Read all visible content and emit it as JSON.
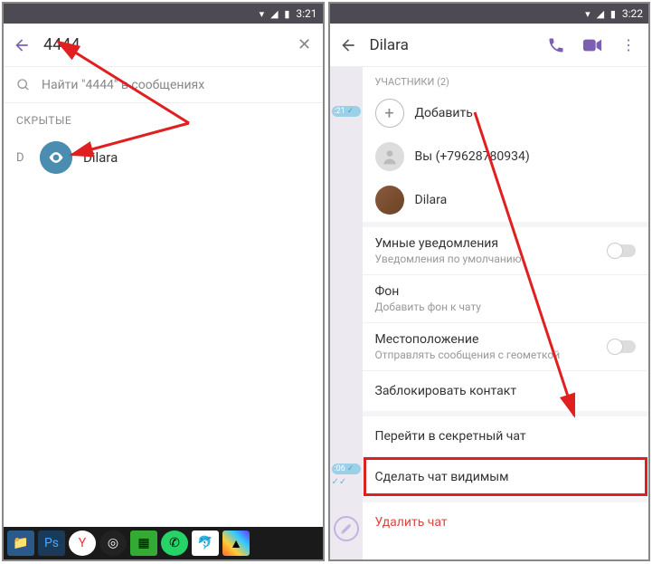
{
  "left": {
    "status_time": "3:21",
    "search_value": "4444",
    "search_hint": "Найти \"4444\" в сообщениях",
    "hidden_label": "СКРЫТЫЕ",
    "letter": "D",
    "contact": "Dilara"
  },
  "right": {
    "status_time": "3:22",
    "title": "Dilara",
    "bubble1": ":21",
    "bubble2": ":06",
    "members_label": "УЧАСТНИКИ (2)",
    "add_label": "Добавить",
    "me_label": "Вы (+79628780934)",
    "contact_label": "Dilara",
    "smart_notif_title": "Умные уведомления",
    "smart_notif_sub": "Уведомления по умолчанию",
    "bg_title": "Фон",
    "bg_sub": "Добавить фон к чату",
    "loc_title": "Местоположение",
    "loc_sub": "Отправлять сообщения с геометкой",
    "block": "Заблокировать контакт",
    "secret": "Перейти в секретный чат",
    "visible": "Сделать чат видимым",
    "delete": "Удалить чат"
  }
}
